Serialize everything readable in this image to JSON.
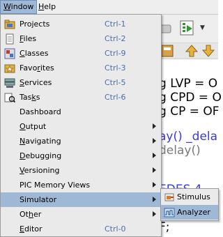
{
  "menubar": {
    "window": {
      "u": "W",
      "rest": "indow"
    },
    "help": {
      "u": "H",
      "rest": "elp"
    }
  },
  "code_lines": [
    {
      "text": "g LVP = O",
      "color": "#000000"
    },
    {
      "text": "g CPD = O",
      "color": "#000000"
    },
    {
      "text": "g CP = OF",
      "color": "#000000"
    },
    {
      "text": "ay() _dela",
      "color": "#3a3adb"
    },
    {
      "text": "delay()",
      "color": "#7a7a7a"
    },
    {
      "text": "EDES 4",
      "color": "#3a3adb"
    },
    {
      "text": "F;",
      "color": "#000000"
    }
  ],
  "window_menu": {
    "items": [
      {
        "id": "projects",
        "pre": "Pro",
        "u": "j",
        "post": "ects",
        "shortcut": "Ctrl-1",
        "icon": "projects-icon",
        "submenu": false,
        "highlighted": false
      },
      {
        "id": "files",
        "pre": "",
        "u": "F",
        "post": "iles",
        "shortcut": "Ctrl-2",
        "icon": "files-icon",
        "submenu": false,
        "highlighted": false
      },
      {
        "id": "classes",
        "pre": "",
        "u": "C",
        "post": "lasses",
        "shortcut": "Ctrl-9",
        "icon": "classes-icon",
        "submenu": false,
        "highlighted": false
      },
      {
        "id": "favorites",
        "pre": "Favo",
        "u": "r",
        "post": "ites",
        "shortcut": "Ctrl-3",
        "icon": "favorites-icon",
        "submenu": false,
        "highlighted": false
      },
      {
        "id": "services",
        "pre": "",
        "u": "S",
        "post": "ervices",
        "shortcut": "Ctrl-5",
        "icon": "services-icon",
        "submenu": false,
        "highlighted": false
      },
      {
        "id": "tasks",
        "pre": "Tas",
        "u": "k",
        "post": "s",
        "shortcut": "Ctrl-6",
        "icon": "tasks-icon",
        "submenu": false,
        "highlighted": false
      },
      {
        "id": "dashboard",
        "pre": "Dashboard",
        "u": "",
        "post": "",
        "shortcut": "",
        "icon": "dashboard-icon",
        "submenu": false,
        "highlighted": false
      },
      {
        "id": "output",
        "pre": "",
        "u": "O",
        "post": "utput",
        "shortcut": "",
        "icon": "",
        "submenu": true,
        "highlighted": false
      },
      {
        "id": "navigating",
        "pre": "",
        "u": "N",
        "post": "avigating",
        "shortcut": "",
        "icon": "",
        "submenu": true,
        "highlighted": false
      },
      {
        "id": "debugging",
        "pre": "",
        "u": "D",
        "post": "ebugging",
        "shortcut": "",
        "icon": "",
        "submenu": true,
        "highlighted": false
      },
      {
        "id": "versioning",
        "pre": "",
        "u": "V",
        "post": "ersioning",
        "shortcut": "",
        "icon": "",
        "submenu": true,
        "highlighted": false
      },
      {
        "id": "pic-memory-views",
        "pre": "PIC Memory Views",
        "u": "",
        "post": "",
        "shortcut": "",
        "icon": "",
        "submenu": true,
        "highlighted": false
      },
      {
        "id": "simulator",
        "pre": "Simulator",
        "u": "",
        "post": "",
        "shortcut": "",
        "icon": "",
        "submenu": true,
        "highlighted": true
      },
      {
        "id": "other",
        "pre": "Ot",
        "u": "h",
        "post": "er",
        "shortcut": "",
        "icon": "",
        "submenu": true,
        "highlighted": false
      },
      {
        "id": "editor",
        "pre": "",
        "u": "E",
        "post": "ditor",
        "shortcut": "Ctrl-0",
        "icon": "",
        "submenu": false,
        "highlighted": false
      }
    ]
  },
  "simulator_submenu": {
    "items": [
      {
        "id": "stimulus",
        "label": "Stimulus",
        "icon": "stimulus-icon",
        "highlighted": false
      },
      {
        "id": "analyzer",
        "label": "Analyzer",
        "icon": "analyzer-icon",
        "highlighted": true
      }
    ]
  },
  "colors": {
    "highlight": "#9fb8d6",
    "shortcut": "#4a6ea8",
    "menu_bg": "#eaeaea"
  }
}
